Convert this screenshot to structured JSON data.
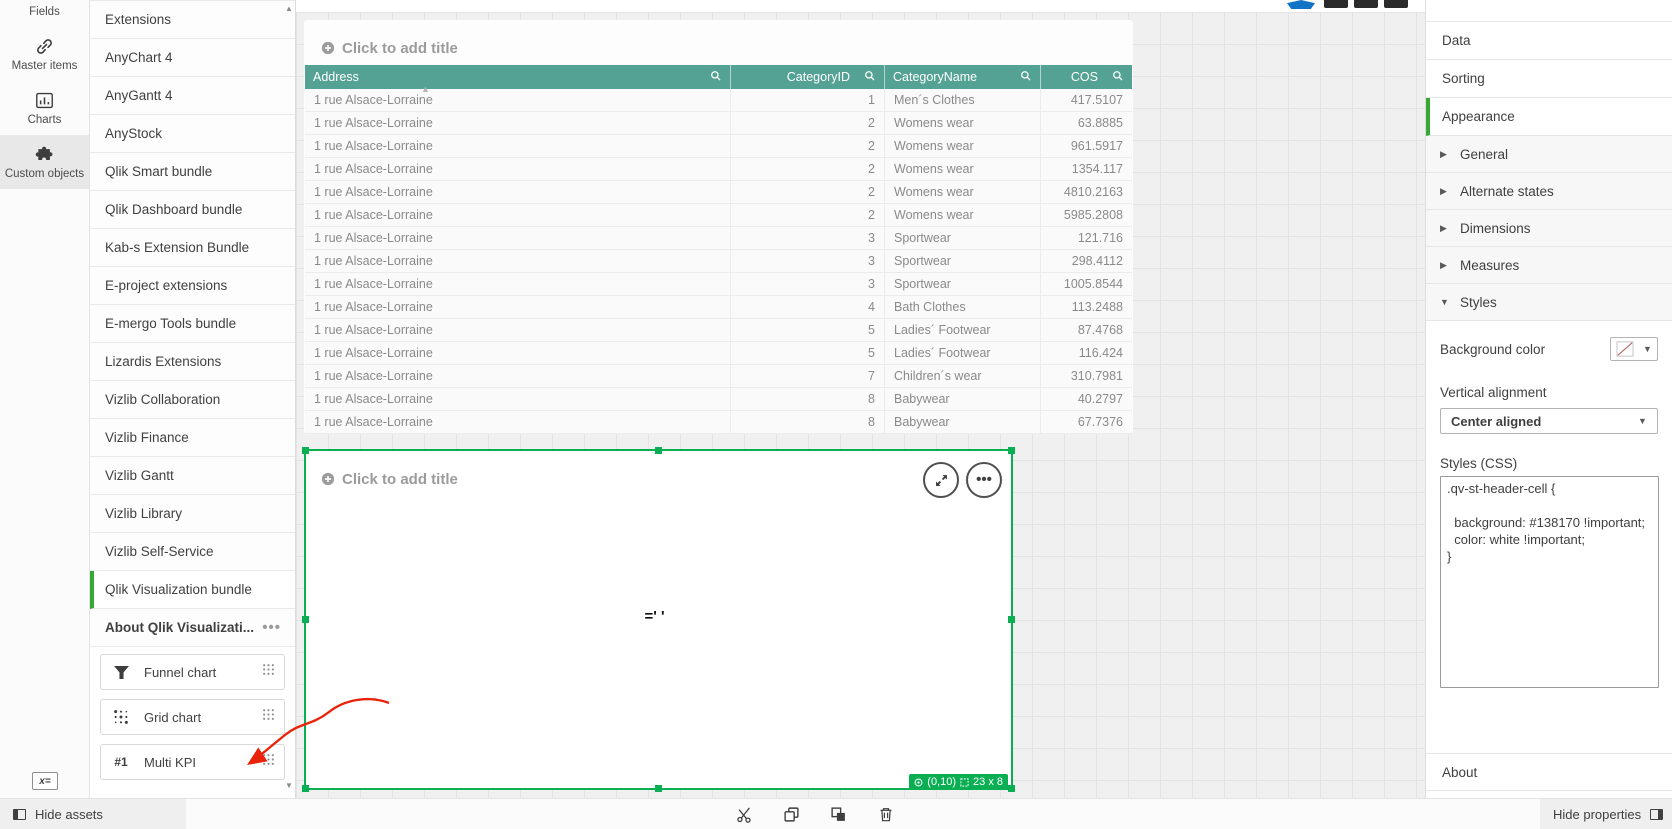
{
  "colors": {
    "table_header_teal": "#54a294",
    "selection_green": "#0aaf54",
    "accent_green": "#36a935",
    "annotation_arrow_red": "#e8230a",
    "css_header_background": "#138170"
  },
  "icon_rail": {
    "items": [
      {
        "label": "Fields",
        "icon": "fields-icon"
      },
      {
        "label": "Master items",
        "icon": "link-icon"
      },
      {
        "label": "Charts",
        "icon": "bar-chart-icon"
      },
      {
        "label": "Custom objects",
        "icon": "puzzle-icon",
        "active": true
      }
    ],
    "variables_button": "x="
  },
  "assets_panel": {
    "items": [
      {
        "label": "Extensions"
      },
      {
        "label": "AnyChart 4"
      },
      {
        "label": "AnyGantt 4"
      },
      {
        "label": "AnyStock"
      },
      {
        "label": "Qlik Smart bundle"
      },
      {
        "label": "Qlik Dashboard bundle"
      },
      {
        "label": "Kab-s Extension Bundle"
      },
      {
        "label": "E-project extensions"
      },
      {
        "label": "E-mergo Tools bundle"
      },
      {
        "label": "Lizardis Extensions"
      },
      {
        "label": "Vizlib Collaboration"
      },
      {
        "label": "Vizlib Finance"
      },
      {
        "label": "Vizlib Gantt"
      },
      {
        "label": "Vizlib Library"
      },
      {
        "label": "Vizlib Self-Service"
      },
      {
        "label": "Qlik Visualization bundle",
        "selected": true
      },
      {
        "label": "About Qlik Visualizati...",
        "bold": true,
        "menu": true
      }
    ],
    "chart_items": [
      {
        "label": "Funnel chart",
        "icon": "funnel-icon"
      },
      {
        "label": "Grid chart",
        "icon": "grid-dots-icon"
      },
      {
        "label": "Multi KPI",
        "icon": "multi-kpi-icon",
        "icon_text": "#1"
      }
    ]
  },
  "table_card": {
    "title_placeholder": "Click to add title",
    "columns": [
      {
        "label": "Address",
        "align": "left"
      },
      {
        "label": "CategoryID",
        "align": "right"
      },
      {
        "label": "CategoryName",
        "align": "left"
      },
      {
        "label": "COS",
        "align": "right"
      }
    ],
    "rows": [
      [
        "1 rue Alsace-Lorraine",
        "1",
        "Men´s Clothes",
        "417.5107"
      ],
      [
        "1 rue Alsace-Lorraine",
        "2",
        "Womens wear",
        "63.8885"
      ],
      [
        "1 rue Alsace-Lorraine",
        "2",
        "Womens wear",
        "961.5917"
      ],
      [
        "1 rue Alsace-Lorraine",
        "2",
        "Womens wear",
        "1354.117"
      ],
      [
        "1 rue Alsace-Lorraine",
        "2",
        "Womens wear",
        "4810.2163"
      ],
      [
        "1 rue Alsace-Lorraine",
        "2",
        "Womens wear",
        "5985.2808"
      ],
      [
        "1 rue Alsace-Lorraine",
        "3",
        "Sportwear",
        "121.716"
      ],
      [
        "1 rue Alsace-Lorraine",
        "3",
        "Sportwear",
        "298.4112"
      ],
      [
        "1 rue Alsace-Lorraine",
        "3",
        "Sportwear",
        "1005.8544"
      ],
      [
        "1 rue Alsace-Lorraine",
        "4",
        "Bath Clothes",
        "113.2488"
      ],
      [
        "1 rue Alsace-Lorraine",
        "5",
        "Ladies´ Footwear",
        "87.4768"
      ],
      [
        "1 rue Alsace-Lorraine",
        "5",
        "Ladies´ Footwear",
        "116.424"
      ],
      [
        "1 rue Alsace-Lorraine",
        "7",
        "Children´s wear",
        "310.7981"
      ],
      [
        "1 rue Alsace-Lorraine",
        "8",
        "Babywear",
        "40.2797"
      ],
      [
        "1 rue Alsace-Lorraine",
        "8",
        "Babywear",
        "67.7376"
      ]
    ]
  },
  "selected_object": {
    "title_placeholder": "Click to add title",
    "content_text": "=' '",
    "badge": {
      "position": "(0,10)",
      "size": "23 x 8"
    }
  },
  "properties_panel": {
    "sections": [
      {
        "label": "Data"
      },
      {
        "label": "Sorting"
      },
      {
        "label": "Appearance",
        "selected": true
      }
    ],
    "accordion": [
      {
        "label": "General",
        "expanded": false
      },
      {
        "label": "Alternate states",
        "expanded": false
      },
      {
        "label": "Dimensions",
        "expanded": false
      },
      {
        "label": "Measures",
        "expanded": false
      },
      {
        "label": "Styles",
        "expanded": true
      }
    ],
    "styles_section": {
      "background_color_label": "Background color",
      "vertical_alignment_label": "Vertical alignment",
      "vertical_alignment_value": "Center aligned",
      "styles_css_label": "Styles (CSS)",
      "css_value": ".qv-st-header-cell {\n\n  background: #138170 !important;\n  color: white !important;\n}"
    },
    "about_label": "About"
  },
  "bottom_bar": {
    "hide_assets_label": "Hide assets",
    "hide_properties_label": "Hide properties"
  }
}
